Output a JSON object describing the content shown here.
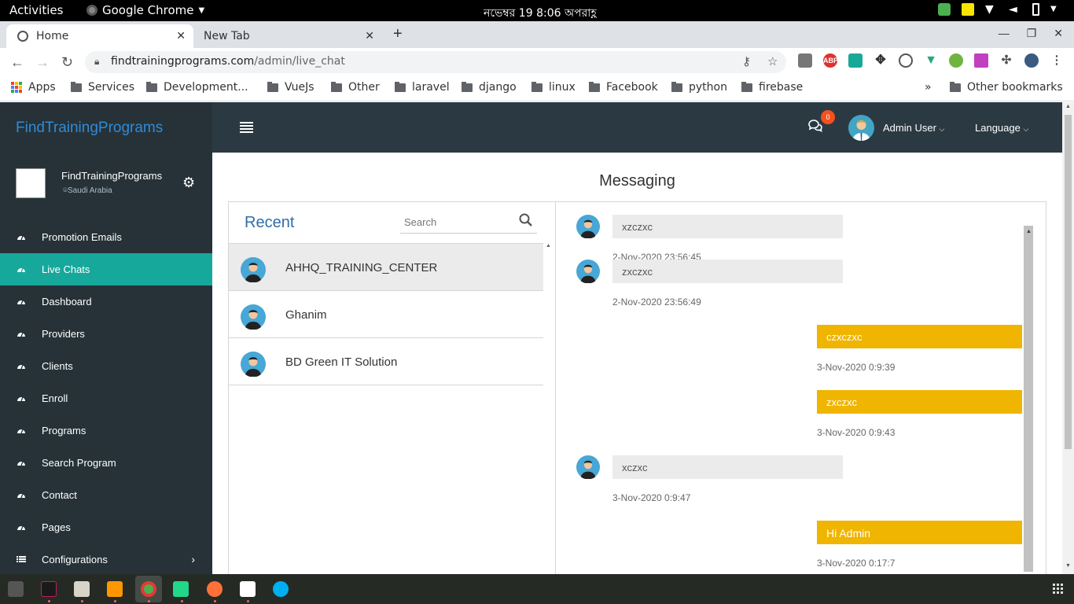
{
  "system": {
    "activities": "Activities",
    "app_name": "Google Chrome",
    "clock": "নভেম্বর 19  8:06 অপরাহ্ণ"
  },
  "browser": {
    "tabs": [
      {
        "label": "Home"
      },
      {
        "label": "New Tab"
      }
    ],
    "url_domain": "findtrainingprograms.com",
    "url_path": "/admin/live_chat",
    "bookmarks": [
      {
        "label": "Apps",
        "icon": "apps-grid-icon"
      },
      {
        "label": "Services"
      },
      {
        "label": "Development..."
      },
      {
        "label": "VueJs"
      },
      {
        "label": "Other"
      },
      {
        "label": "laravel"
      },
      {
        "label": "django"
      },
      {
        "label": "linux"
      },
      {
        "label": "Facebook"
      },
      {
        "label": "python"
      },
      {
        "label": "firebase"
      }
    ],
    "overflow": "»",
    "other_bookmarks": "Other bookmarks",
    "extension_abp": "ABP"
  },
  "app": {
    "brand": "FindTrainingPrograms",
    "chat_badge": "0",
    "user": "Admin User",
    "language": "Language",
    "profile": {
      "name": "FindTrainingPrograms",
      "location": "Saudi Arabia"
    },
    "menu": [
      {
        "label": "Promotion Emails",
        "active": false
      },
      {
        "label": "Live Chats",
        "active": true
      },
      {
        "label": "Dashboard",
        "active": false
      },
      {
        "label": "Providers",
        "active": false
      },
      {
        "label": "Clients",
        "active": false
      },
      {
        "label": "Enroll",
        "active": false
      },
      {
        "label": "Programs",
        "active": false
      },
      {
        "label": "Search Program",
        "active": false
      },
      {
        "label": "Contact",
        "active": false
      },
      {
        "label": "Pages",
        "active": false
      },
      {
        "label": "Configurations",
        "active": false,
        "has_children": true
      }
    ],
    "page_title": "Messaging",
    "recent_label": "Recent",
    "search_placeholder": "Search",
    "conversations": [
      {
        "name": "AHHQ_TRAINING_CENTER",
        "selected": true
      },
      {
        "name": "Ghanim",
        "selected": false
      },
      {
        "name": "BD Green IT Solution",
        "selected": false
      }
    ],
    "messages": [
      {
        "direction": "in",
        "text": "xzczxc",
        "time": "2-Nov-2020 23:56:45"
      },
      {
        "direction": "in",
        "text": "zxczxc",
        "time": "2-Nov-2020 23:56:49"
      },
      {
        "direction": "out",
        "text": "czxczxc",
        "time": "3-Nov-2020 0:9:39"
      },
      {
        "direction": "out",
        "text": "zxczxc",
        "time": "3-Nov-2020 0:9:43"
      },
      {
        "direction": "in",
        "text": "xczxc",
        "time": "3-Nov-2020 0:9:47"
      },
      {
        "direction": "out",
        "text": "Hi Admin",
        "time": "3-Nov-2020 0:17:7"
      }
    ]
  },
  "colors": {
    "sidebar": "#263238",
    "header": "#2b3a42",
    "active_menu": "#17a89c",
    "brand_text": "#2f8bd8",
    "outgoing_bubble": "#f0b500",
    "incoming_bubble": "#ebebeb"
  }
}
